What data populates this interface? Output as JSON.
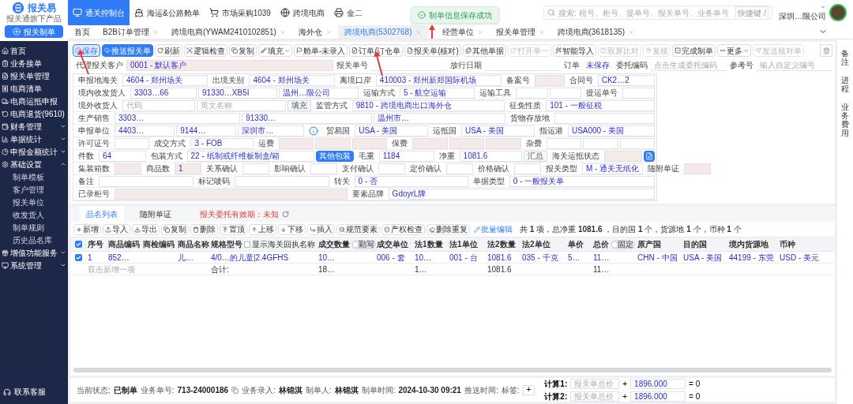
{
  "logo": {
    "name": "报关易",
    "tagline": "报关通旗下产品"
  },
  "create_button": "报关制单",
  "nav": [
    {
      "label": "通关控制台",
      "selected": true
    },
    {
      "label": "海运&公路舱单",
      "selected": false
    },
    {
      "label": "市场采购1039",
      "selected": false
    },
    {
      "label": "跨境电商",
      "selected": false
    },
    {
      "label": "金二",
      "selected": false
    }
  ],
  "toast": "制单信息保存成功",
  "search": {
    "placeholder": "搜索: 税号、柜号、提单号、报关单号、业务单号",
    "shortcut": "快捷键 /"
  },
  "user": {
    "company": "深圳…限公司"
  },
  "sidebar": [
    {
      "label": "首页",
      "selected": false
    },
    {
      "label": "业务接单",
      "selected": false
    },
    {
      "label": "报关单管理",
      "selected": false
    },
    {
      "label": "电商清单",
      "selected": false
    },
    {
      "label": "电商运抵申报",
      "selected": false
    },
    {
      "label": "电商退货(9610)",
      "selected": false
    },
    {
      "label": "财务管理",
      "selected": false,
      "expanded": false
    },
    {
      "label": "单据统计",
      "selected": false,
      "expanded": false
    },
    {
      "label": "申报金额统计",
      "selected": false,
      "expanded": false
    },
    {
      "label": "基础设置",
      "selected": false,
      "expanded": true,
      "children": [
        {
          "label": "制单模板",
          "selected": false
        },
        {
          "label": "客户管理",
          "selected": false
        },
        {
          "label": "报关单位",
          "selected": false
        },
        {
          "label": "收发货人",
          "selected": false
        },
        {
          "label": "制单规则",
          "selected": false
        },
        {
          "label": "历史品名库",
          "selected": false
        }
      ]
    },
    {
      "label": "增值功能服务",
      "selected": false,
      "expanded": false
    },
    {
      "label": "系统管理",
      "selected": false,
      "expanded": false
    }
  ],
  "support": "联系客服",
  "tabs": [
    {
      "label": "首页",
      "selected": false
    },
    {
      "label": "B2B订单管理",
      "selected": false
    },
    {
      "label": "跨境电商(YWAM2410102851)",
      "selected": false
    },
    {
      "label": "海外仓",
      "selected": false
    },
    {
      "label": "跨境电商(5302768)",
      "selected": true
    },
    {
      "label": "经营单位",
      "selected": false
    },
    {
      "label": "报关单管理",
      "selected": false
    },
    {
      "label": "跨境电商(3618135)",
      "selected": false
    }
  ],
  "right_rail": [
    "备注",
    "进程",
    "业务费用"
  ],
  "toolbar": [
    {
      "label": "保存",
      "kind": "focus"
    },
    {
      "label": "推送报关单",
      "kind": "primary"
    },
    {
      "label": "刷新",
      "kind": "plain"
    },
    {
      "label": "逻辑检查",
      "kind": "plain"
    },
    {
      "label": "复制",
      "kind": "plain"
    },
    {
      "label": "填充",
      "kind": "dropdown"
    },
    {
      "label": "舱单-未录入",
      "kind": "plain"
    },
    {
      "label": "订单/订仓单",
      "kind": "plain"
    },
    {
      "label": "报关单(核对)",
      "kind": "plain"
    },
    {
      "label": "其他单据",
      "kind": "plain"
    },
    {
      "label": "打开单一",
      "kind": "disabled"
    },
    {
      "label": "智能导入",
      "kind": "plain"
    },
    {
      "label": "双屏比对",
      "kind": "disabled"
    },
    {
      "label": "复核",
      "kind": "disabled"
    },
    {
      "label": "完成制单",
      "kind": "plain"
    },
    {
      "label": "更多",
      "kind": "dropdown"
    },
    {
      "label": "发送核对单",
      "kind": "disabled"
    }
  ],
  "header_fields": [
    {
      "kind": "label",
      "text": "代理报关客户"
    },
    {
      "kind": "locked",
      "value": "0001 - 默认客户"
    },
    {
      "kind": "label",
      "text": "报关单号"
    },
    {
      "kind": "line"
    },
    {
      "kind": "label",
      "text": "放行日期"
    },
    {
      "kind": "line"
    },
    {
      "kind": "label",
      "text": "订单"
    },
    {
      "kind": "status",
      "text": "未保存"
    },
    {
      "kind": "label",
      "text": "委托编码"
    },
    {
      "kind": "line",
      "placeholder": "点击生成委托编码"
    },
    {
      "kind": "label",
      "text": "参考号"
    },
    {
      "kind": "line",
      "placeholder": "输入自定义编号"
    }
  ],
  "form_rows": [
    [
      {
        "kind": "label",
        "text": "申报地海关"
      },
      {
        "kind": "input",
        "value": "4604 - 郑州场关"
      },
      {
        "kind": "label",
        "text": "出境关别"
      },
      {
        "kind": "input",
        "value": "4604 - 郑州场关"
      },
      {
        "kind": "label",
        "text": "离境口岸"
      },
      {
        "kind": "input",
        "value": "410003 - 郑州新郑国际机场"
      },
      {
        "kind": "label",
        "text": "备案号"
      },
      {
        "kind": "locked"
      },
      {
        "kind": "label",
        "text": "合同号"
      },
      {
        "kind": "input",
        "value": "CK2…2"
      }
    ],
    [
      {
        "kind": "label",
        "text": "境内收发货人"
      },
      {
        "kind": "input",
        "value": "3303…66"
      },
      {
        "kind": "input",
        "value": "91330…XB5I"
      },
      {
        "kind": "input",
        "value": "温州…限公司"
      },
      {
        "kind": "label",
        "text": "运输方式"
      },
      {
        "kind": "input",
        "value": "5 - 航空运输"
      },
      {
        "kind": "label",
        "text": "运输工具"
      },
      {
        "kind": "input"
      },
      {
        "kind": "input"
      },
      {
        "kind": "label",
        "text": "提运单号"
      },
      {
        "kind": "input"
      }
    ],
    [
      {
        "kind": "label",
        "text": "境外收货人"
      },
      {
        "kind": "input",
        "placeholder": "代码"
      },
      {
        "kind": "input",
        "placeholder": "英文名称"
      },
      {
        "kind": "button",
        "text": "填充"
      },
      {
        "kind": "label",
        "text": "监管方式"
      },
      {
        "kind": "input",
        "value": "9810 - 跨境电商出口海外仓"
      },
      {
        "kind": "label",
        "text": "征免性质"
      },
      {
        "kind": "input",
        "value": "101 - 一般征税"
      }
    ],
    [
      {
        "kind": "label",
        "text": "生产销售"
      },
      {
        "kind": "input",
        "value": "3303…"
      },
      {
        "kind": "input",
        "value": "91330…"
      },
      {
        "kind": "input",
        "value": "温州市…"
      },
      {
        "kind": "label",
        "text": "货物存放地"
      },
      {
        "kind": "input"
      }
    ],
    [
      {
        "kind": "label",
        "text": "申报单位"
      },
      {
        "kind": "input",
        "value": "4403…"
      },
      {
        "kind": "input",
        "value": "9144…"
      },
      {
        "kind": "input",
        "value": "深圳市…"
      },
      {
        "kind": "info"
      },
      {
        "kind": "label",
        "text": "贸易国"
      },
      {
        "kind": "input",
        "value": "USA - 美国"
      },
      {
        "kind": "label",
        "text": "运抵国"
      },
      {
        "kind": "input",
        "value": "USA - 美国"
      },
      {
        "kind": "label",
        "text": "指运港"
      },
      {
        "kind": "input",
        "value": "USA000 - 美国"
      }
    ],
    [
      {
        "kind": "label",
        "text": "许可证号"
      },
      {
        "kind": "input"
      },
      {
        "kind": "label",
        "text": "成交方式"
      },
      {
        "kind": "input",
        "value": "3 - FOB"
      },
      {
        "kind": "label",
        "text": "运费"
      },
      {
        "kind": "locked"
      },
      {
        "kind": "locked"
      },
      {
        "kind": "locked"
      },
      {
        "kind": "label",
        "text": "保费"
      },
      {
        "kind": "locked"
      },
      {
        "kind": "locked"
      },
      {
        "kind": "locked"
      },
      {
        "kind": "label",
        "text": "杂费"
      },
      {
        "kind": "input"
      },
      {
        "kind": "input"
      },
      {
        "kind": "input"
      }
    ],
    [
      {
        "kind": "label",
        "text": "件数"
      },
      {
        "kind": "input",
        "value": "64"
      },
      {
        "kind": "label",
        "text": "包装方式"
      },
      {
        "kind": "input",
        "value": "22 - 纸制或纤维板制盒/箱"
      },
      {
        "kind": "primary",
        "text": "其他包装"
      },
      {
        "kind": "label",
        "text": "毛重"
      },
      {
        "kind": "input",
        "value": "1184"
      },
      {
        "kind": "label",
        "text": "净重"
      },
      {
        "kind": "input",
        "value": "1081.6"
      },
      {
        "kind": "button",
        "text": "汇总"
      },
      {
        "kind": "label",
        "text": "海关运抵状态"
      },
      {
        "kind": "locked"
      },
      {
        "kind": "doc"
      }
    ],
    [
      {
        "kind": "label",
        "text": "集装箱数"
      },
      {
        "kind": "locked"
      },
      {
        "kind": "label",
        "text": "商品数"
      },
      {
        "kind": "locked",
        "value": "1"
      },
      {
        "kind": "label",
        "text": "关系确认"
      },
      {
        "kind": "input"
      },
      {
        "kind": "label",
        "text": "影响确认"
      },
      {
        "kind": "input"
      },
      {
        "kind": "label",
        "text": "支付确认"
      },
      {
        "kind": "input"
      },
      {
        "kind": "label",
        "text": "定价确认"
      },
      {
        "kind": "input"
      },
      {
        "kind": "label",
        "text": "价格确认"
      },
      {
        "kind": "input"
      },
      {
        "kind": "label",
        "text": "报关类型"
      },
      {
        "kind": "input",
        "value": "M - 通关无纸化"
      },
      {
        "kind": "label",
        "text": "随附单证"
      },
      {
        "kind": "locked"
      }
    ],
    [
      {
        "kind": "label",
        "text": "备注"
      },
      {
        "kind": "input"
      },
      {
        "kind": "label",
        "text": "标记唛码"
      },
      {
        "kind": "input"
      },
      {
        "kind": "label",
        "text": "转关"
      },
      {
        "kind": "input",
        "value": "0 - 否"
      },
      {
        "kind": "label",
        "text": "单据类型"
      },
      {
        "kind": "input",
        "value": "0 - 一般报关单"
      }
    ],
    [
      {
        "kind": "label",
        "text": "已录柜号"
      },
      {
        "kind": "locked"
      },
      {
        "kind": "label",
        "text": "要素品牌"
      },
      {
        "kind": "input",
        "value": "GdoyrL牌"
      }
    ]
  ],
  "item_tabs": [
    {
      "label": "品名列表",
      "selected": true
    },
    {
      "label": "随附单证",
      "selected": false
    }
  ],
  "validity": "报关委托有效期：未知",
  "item_toolbar": [
    {
      "label": "新增",
      "kind": "plain"
    },
    {
      "label": "导入",
      "kind": "plain"
    },
    {
      "label": "导出",
      "kind": "plain"
    },
    {
      "label": "复制",
      "kind": "plain"
    },
    {
      "label": "删除",
      "kind": "plain"
    },
    {
      "label": "置顶",
      "kind": "plain"
    },
    {
      "label": "上移",
      "kind": "plain"
    },
    {
      "label": "下移",
      "kind": "plain"
    },
    {
      "label": "插入",
      "kind": "plain"
    },
    {
      "label": "规范要素",
      "kind": "plain"
    },
    {
      "label": "产权检查",
      "kind": "plain"
    },
    {
      "label": "删除重复",
      "kind": "plain"
    },
    {
      "label": "批量编辑",
      "kind": "accent"
    }
  ],
  "summary": "共 **1** 项，总净重 **1081.6** ，目的国 **1** 个，货源地 **1** 个，币种 **1** 个",
  "table": {
    "all_checked": true,
    "columns": [
      {
        "label": "序号"
      },
      {
        "label": "商品编码"
      },
      {
        "label": "商检编码"
      },
      {
        "label": "商品名称"
      },
      {
        "label": "规格型号",
        "option": "显示海关回执名称",
        "checked": false
      },
      {
        "label": "成交数量",
        "toggle": "勤写",
        "on": false
      },
      {
        "label": "成交单位"
      },
      {
        "label": "法1数量"
      },
      {
        "label": "法1单位"
      },
      {
        "label": "法2数量"
      },
      {
        "label": "法2单位"
      },
      {
        "label": "单价"
      },
      {
        "label": "总价",
        "toggle": "固定",
        "on": false
      },
      {
        "label": "原产国"
      },
      {
        "label": "目的国"
      },
      {
        "label": "境内货源地"
      },
      {
        "label": "币种"
      }
    ],
    "rows": [
      {
        "checked": true,
        "cells": [
          "1",
          "852…",
          "",
          "儿…",
          "4/0…的儿童|2.4GFHS",
          "10…",
          "006 - 套",
          "10…",
          "001 - 台",
          "1081.6",
          "035 - 千克",
          "5…",
          "11…",
          "CHN - 中国",
          "USA - 美国",
          "44199 - 东莞",
          "USD - 美元"
        ]
      }
    ],
    "new_row_placeholder": "双击新增一项",
    "totals": {
      "label": "合计:",
      "cells": [
        "",
        "",
        "",
        "",
        "",
        "18…",
        "",
        "1…",
        "",
        "1081.6",
        "",
        "",
        "11…",
        "",
        "",
        "",
        ""
      ]
    }
  },
  "footer": {
    "pairs": [
      {
        "label": "当前状态:",
        "value": "已制单"
      },
      {
        "label": "业务单号:",
        "value": "713-24000186",
        "copy": true
      },
      {
        "label": "业务录入:",
        "value": "林锦淇"
      },
      {
        "label": "制单人:",
        "value": "林锦淇"
      },
      {
        "label": "制单时间:",
        "value": "2024-10-30 09:21"
      },
      {
        "label": "推送时间:"
      },
      {
        "label": "标签:"
      }
    ],
    "tag_add": "+",
    "calcs": [
      {
        "label": "计算1:",
        "placeholder": "报关单总价",
        "op": "+",
        "value": "1896.000",
        "result": "= 0"
      },
      {
        "label": "计算2:",
        "placeholder": "报关单总价",
        "op": "+",
        "value": "1896.000",
        "result": "= 0"
      }
    ]
  }
}
